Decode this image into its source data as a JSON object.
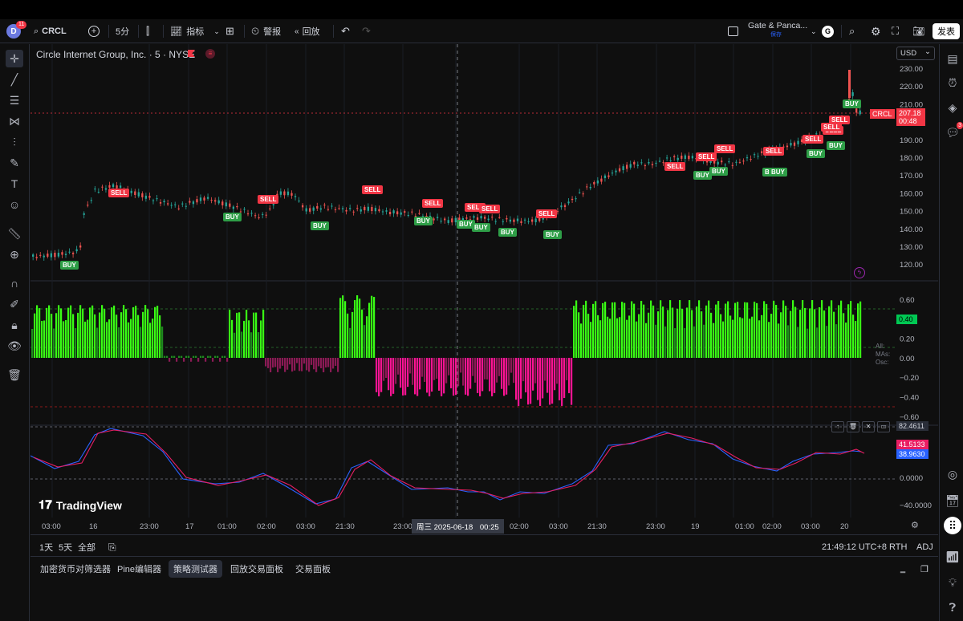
{
  "toolbar": {
    "symbol": "CRCL",
    "notif_count": "11",
    "interval": "5分",
    "indicators": "指标",
    "alert": "警报",
    "replay": "回放",
    "layout_name": "Gate & Panca...",
    "layout_sub": "保存",
    "publish": "发表",
    "avatar_letter": "G"
  },
  "legend": {
    "title": "Circle Internet Group, Inc. · 5 · NYSE",
    "currency": "USD"
  },
  "price_axis": {
    "labels": [
      "230.00",
      "220.00",
      "210.00",
      "200.00",
      "190.00",
      "180.00",
      "170.00",
      "160.00",
      "150.00",
      "140.00",
      "130.00",
      "120.00"
    ],
    "symbol_tag": "CRCL",
    "last_price": "207.18",
    "countdown": "00:48"
  },
  "osc_axis": {
    "labels": [
      "0.60",
      "0.40",
      "0.20",
      "0.00",
      "−0.20",
      "−0.40",
      "−0.60"
    ],
    "value_tag": "0.40",
    "legend": [
      "All:",
      "MAs:",
      "Osc:"
    ]
  },
  "rsi_axis": {
    "labels": [
      "82.4611",
      "0.0000",
      "−40.0000"
    ],
    "red_tag": "41.5133",
    "blue_tag": "38.9630"
  },
  "time_axis": {
    "labels": [
      "03:00",
      "16",
      "23:00",
      "17",
      "01:00",
      "02:00",
      "03:00",
      "21:30",
      "23:00",
      "00:25",
      "02:00",
      "03:00",
      "21:30",
      "23:00",
      "19",
      "01:00",
      "02:00",
      "03:00",
      "20"
    ],
    "crosshair_label": "周三 2025-06-18"
  },
  "signals": {
    "sell": "SELL",
    "buy": "BUY"
  },
  "watermark": "TradingView",
  "bottombar": {
    "range_1d": "1天",
    "range_5d": "5天",
    "range_all": "全部",
    "clock": "21:49:12 UTC+8",
    "session": "RTH",
    "adj": "ADJ"
  },
  "panel_tabs": [
    "加密货币对筛选器",
    "Pine编辑器",
    "策略测试器",
    "回放交易面板",
    "交易面板"
  ],
  "colors": {
    "up": "#26a69a",
    "down": "#ef5350",
    "sell": "#f23645",
    "buy": "#2e9e47",
    "osc_pos": "#2bd62b",
    "osc_neg": "#e91e7a",
    "rsi_blue": "#2962ff",
    "rsi_red": "#e91e63"
  }
}
